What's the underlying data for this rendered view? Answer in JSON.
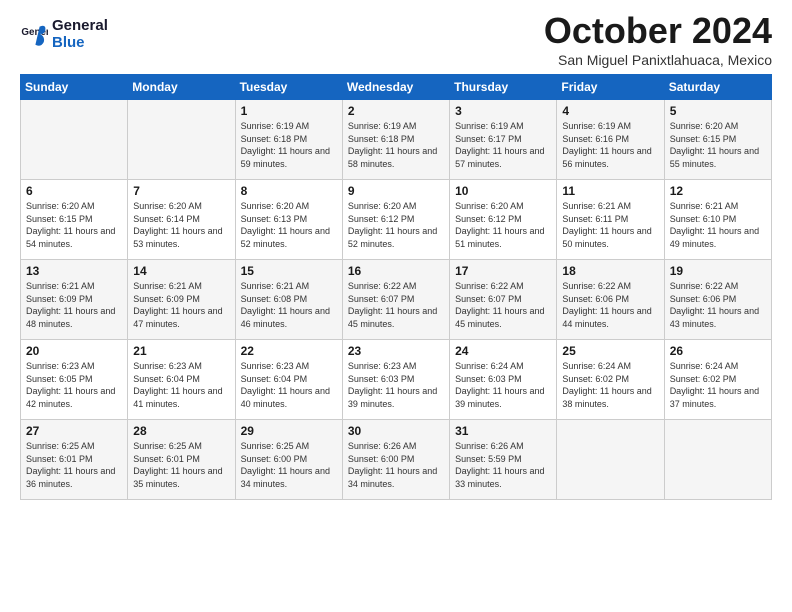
{
  "logo": {
    "line1": "General",
    "line2": "Blue"
  },
  "title": "October 2024",
  "location": "San Miguel Panixtlahuaca, Mexico",
  "weekdays": [
    "Sunday",
    "Monday",
    "Tuesday",
    "Wednesday",
    "Thursday",
    "Friday",
    "Saturday"
  ],
  "weeks": [
    [
      {
        "day": "",
        "sunrise": "",
        "sunset": "",
        "daylight": ""
      },
      {
        "day": "",
        "sunrise": "",
        "sunset": "",
        "daylight": ""
      },
      {
        "day": "1",
        "sunrise": "Sunrise: 6:19 AM",
        "sunset": "Sunset: 6:18 PM",
        "daylight": "Daylight: 11 hours and 59 minutes."
      },
      {
        "day": "2",
        "sunrise": "Sunrise: 6:19 AM",
        "sunset": "Sunset: 6:18 PM",
        "daylight": "Daylight: 11 hours and 58 minutes."
      },
      {
        "day": "3",
        "sunrise": "Sunrise: 6:19 AM",
        "sunset": "Sunset: 6:17 PM",
        "daylight": "Daylight: 11 hours and 57 minutes."
      },
      {
        "day": "4",
        "sunrise": "Sunrise: 6:19 AM",
        "sunset": "Sunset: 6:16 PM",
        "daylight": "Daylight: 11 hours and 56 minutes."
      },
      {
        "day": "5",
        "sunrise": "Sunrise: 6:20 AM",
        "sunset": "Sunset: 6:15 PM",
        "daylight": "Daylight: 11 hours and 55 minutes."
      }
    ],
    [
      {
        "day": "6",
        "sunrise": "Sunrise: 6:20 AM",
        "sunset": "Sunset: 6:15 PM",
        "daylight": "Daylight: 11 hours and 54 minutes."
      },
      {
        "day": "7",
        "sunrise": "Sunrise: 6:20 AM",
        "sunset": "Sunset: 6:14 PM",
        "daylight": "Daylight: 11 hours and 53 minutes."
      },
      {
        "day": "8",
        "sunrise": "Sunrise: 6:20 AM",
        "sunset": "Sunset: 6:13 PM",
        "daylight": "Daylight: 11 hours and 52 minutes."
      },
      {
        "day": "9",
        "sunrise": "Sunrise: 6:20 AM",
        "sunset": "Sunset: 6:12 PM",
        "daylight": "Daylight: 11 hours and 52 minutes."
      },
      {
        "day": "10",
        "sunrise": "Sunrise: 6:20 AM",
        "sunset": "Sunset: 6:12 PM",
        "daylight": "Daylight: 11 hours and 51 minutes."
      },
      {
        "day": "11",
        "sunrise": "Sunrise: 6:21 AM",
        "sunset": "Sunset: 6:11 PM",
        "daylight": "Daylight: 11 hours and 50 minutes."
      },
      {
        "day": "12",
        "sunrise": "Sunrise: 6:21 AM",
        "sunset": "Sunset: 6:10 PM",
        "daylight": "Daylight: 11 hours and 49 minutes."
      }
    ],
    [
      {
        "day": "13",
        "sunrise": "Sunrise: 6:21 AM",
        "sunset": "Sunset: 6:09 PM",
        "daylight": "Daylight: 11 hours and 48 minutes."
      },
      {
        "day": "14",
        "sunrise": "Sunrise: 6:21 AM",
        "sunset": "Sunset: 6:09 PM",
        "daylight": "Daylight: 11 hours and 47 minutes."
      },
      {
        "day": "15",
        "sunrise": "Sunrise: 6:21 AM",
        "sunset": "Sunset: 6:08 PM",
        "daylight": "Daylight: 11 hours and 46 minutes."
      },
      {
        "day": "16",
        "sunrise": "Sunrise: 6:22 AM",
        "sunset": "Sunset: 6:07 PM",
        "daylight": "Daylight: 11 hours and 45 minutes."
      },
      {
        "day": "17",
        "sunrise": "Sunrise: 6:22 AM",
        "sunset": "Sunset: 6:07 PM",
        "daylight": "Daylight: 11 hours and 45 minutes."
      },
      {
        "day": "18",
        "sunrise": "Sunrise: 6:22 AM",
        "sunset": "Sunset: 6:06 PM",
        "daylight": "Daylight: 11 hours and 44 minutes."
      },
      {
        "day": "19",
        "sunrise": "Sunrise: 6:22 AM",
        "sunset": "Sunset: 6:06 PM",
        "daylight": "Daylight: 11 hours and 43 minutes."
      }
    ],
    [
      {
        "day": "20",
        "sunrise": "Sunrise: 6:23 AM",
        "sunset": "Sunset: 6:05 PM",
        "daylight": "Daylight: 11 hours and 42 minutes."
      },
      {
        "day": "21",
        "sunrise": "Sunrise: 6:23 AM",
        "sunset": "Sunset: 6:04 PM",
        "daylight": "Daylight: 11 hours and 41 minutes."
      },
      {
        "day": "22",
        "sunrise": "Sunrise: 6:23 AM",
        "sunset": "Sunset: 6:04 PM",
        "daylight": "Daylight: 11 hours and 40 minutes."
      },
      {
        "day": "23",
        "sunrise": "Sunrise: 6:23 AM",
        "sunset": "Sunset: 6:03 PM",
        "daylight": "Daylight: 11 hours and 39 minutes."
      },
      {
        "day": "24",
        "sunrise": "Sunrise: 6:24 AM",
        "sunset": "Sunset: 6:03 PM",
        "daylight": "Daylight: 11 hours and 39 minutes."
      },
      {
        "day": "25",
        "sunrise": "Sunrise: 6:24 AM",
        "sunset": "Sunset: 6:02 PM",
        "daylight": "Daylight: 11 hours and 38 minutes."
      },
      {
        "day": "26",
        "sunrise": "Sunrise: 6:24 AM",
        "sunset": "Sunset: 6:02 PM",
        "daylight": "Daylight: 11 hours and 37 minutes."
      }
    ],
    [
      {
        "day": "27",
        "sunrise": "Sunrise: 6:25 AM",
        "sunset": "Sunset: 6:01 PM",
        "daylight": "Daylight: 11 hours and 36 minutes."
      },
      {
        "day": "28",
        "sunrise": "Sunrise: 6:25 AM",
        "sunset": "Sunset: 6:01 PM",
        "daylight": "Daylight: 11 hours and 35 minutes."
      },
      {
        "day": "29",
        "sunrise": "Sunrise: 6:25 AM",
        "sunset": "Sunset: 6:00 PM",
        "daylight": "Daylight: 11 hours and 34 minutes."
      },
      {
        "day": "30",
        "sunrise": "Sunrise: 6:26 AM",
        "sunset": "Sunset: 6:00 PM",
        "daylight": "Daylight: 11 hours and 34 minutes."
      },
      {
        "day": "31",
        "sunrise": "Sunrise: 6:26 AM",
        "sunset": "Sunset: 5:59 PM",
        "daylight": "Daylight: 11 hours and 33 minutes."
      },
      {
        "day": "",
        "sunrise": "",
        "sunset": "",
        "daylight": ""
      },
      {
        "day": "",
        "sunrise": "",
        "sunset": "",
        "daylight": ""
      }
    ]
  ]
}
